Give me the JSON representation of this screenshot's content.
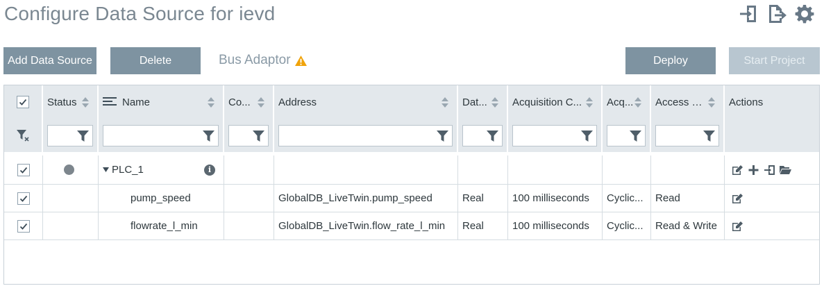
{
  "page": {
    "title": "Configure Data Source for ievd"
  },
  "header_icons": [
    "import-icon",
    "export-icon",
    "settings-gear-icon"
  ],
  "toolbar": {
    "add_label": "Add Data Source",
    "delete_label": "Delete",
    "bus_adaptor_label": "Bus Adaptor",
    "deploy_label": "Deploy",
    "start_label": "Start Project"
  },
  "colors": {
    "button": "#7e93a1",
    "button_disabled": "#b8c6d0",
    "header_bg": "#e3e8ec",
    "warning": "#f0a30a"
  },
  "table": {
    "columns": [
      "Status",
      "Name",
      "Co...",
      "Address",
      "Dat...",
      "Acquisition C...",
      "Acq...",
      "Access M...",
      "Actions"
    ],
    "group": {
      "name": "PLC_1",
      "status": "offline"
    },
    "rows": [
      {
        "name": "pump_speed",
        "address": "GlobalDB_LiveTwin.pump_speed",
        "data_type": "Real",
        "acquisition_cycle": "100 milliseconds",
        "acquisition_mode": "Cyclic...",
        "access_mode": "Read"
      },
      {
        "name": "flowrate_l_min",
        "address": "GlobalDB_LiveTwin.flow_rate_l_min",
        "data_type": "Real",
        "acquisition_cycle": "100 milliseconds",
        "acquisition_mode": "Cyclic...",
        "access_mode": "Read & Write"
      }
    ]
  }
}
